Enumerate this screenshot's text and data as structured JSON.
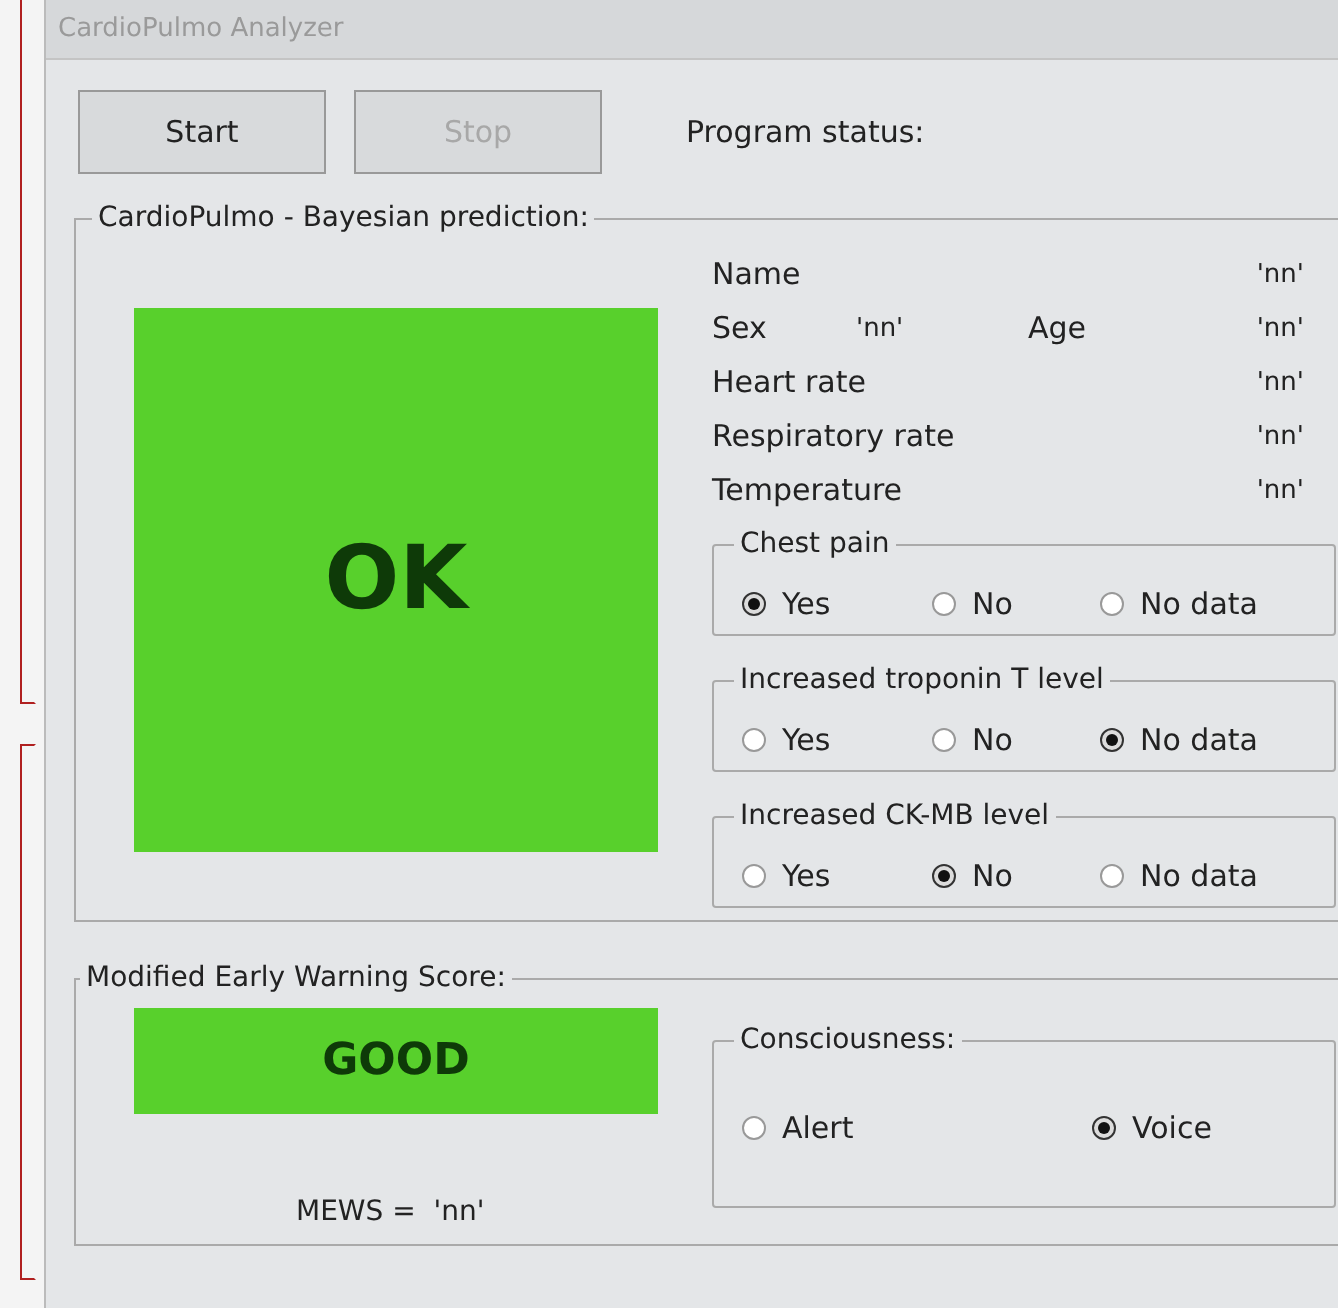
{
  "window": {
    "title": "CardioPulmo Analyzer"
  },
  "buttons": [
    {
      "label": "Start",
      "disabled": false
    },
    {
      "label": "Stop",
      "disabled": true
    }
  ],
  "program_status": {
    "label": "Program status:"
  },
  "prediction": {
    "title": "CardioPulmo - Bayesian prediction:",
    "result": "OK",
    "name": {
      "label": "Name",
      "value": "'nn'"
    },
    "sex": {
      "label": "Sex",
      "value": "'nn'"
    },
    "age": {
      "label": "Age",
      "value": "'nn'"
    },
    "fields": [
      {
        "label": "Heart rate",
        "value": "'nn'"
      },
      {
        "label": "Respiratory rate",
        "value": "'nn'"
      },
      {
        "label": "Temperature",
        "value": "'nn'"
      }
    ],
    "groups": [
      {
        "title": "Chest pain",
        "options": [
          {
            "label": "Yes",
            "selected": true
          },
          {
            "label": "No",
            "selected": false
          },
          {
            "label": "No data",
            "selected": false
          }
        ]
      },
      {
        "title": "Increased troponin T level",
        "options": [
          {
            "label": "Yes",
            "selected": false
          },
          {
            "label": "No",
            "selected": false
          },
          {
            "label": "No data",
            "selected": true
          }
        ]
      },
      {
        "title": "Increased CK-MB level",
        "options": [
          {
            "label": "Yes",
            "selected": false
          },
          {
            "label": "No",
            "selected": true
          },
          {
            "label": "No data",
            "selected": false
          }
        ]
      }
    ]
  },
  "mews": {
    "title": "Modified Early Warning Score:",
    "result": "GOOD",
    "formula": "MEWS =  'nn'",
    "consciousness": {
      "title": "Consciousness:",
      "options": [
        {
          "label": "Alert",
          "selected": false
        },
        {
          "label": "Voice",
          "selected": true
        }
      ]
    }
  }
}
